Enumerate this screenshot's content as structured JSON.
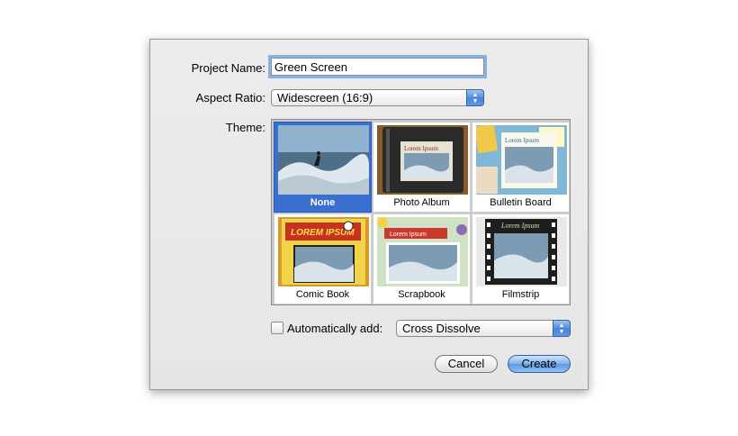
{
  "project_name": {
    "label": "Project Name:",
    "value": "Green Screen"
  },
  "aspect_ratio": {
    "label": "Aspect Ratio:",
    "value": "Widescreen (16:9)"
  },
  "theme": {
    "label": "Theme:",
    "selected": "None",
    "items": [
      {
        "name": "None",
        "thumb_text": ""
      },
      {
        "name": "Photo Album",
        "thumb_text": "Lorem Ipsum"
      },
      {
        "name": "Bulletin Board",
        "thumb_text": "Lorem Ipsum"
      },
      {
        "name": "Comic Book",
        "thumb_text": "LOREM IPSUM"
      },
      {
        "name": "Scrapbook",
        "thumb_text": "Lorem Ipsum"
      },
      {
        "name": "Filmstrip",
        "thumb_text": "Lorem Ipsum"
      }
    ]
  },
  "auto_add": {
    "label": "Automatically add:",
    "checked": false,
    "value": "Cross Dissolve"
  },
  "buttons": {
    "cancel": "Cancel",
    "create": "Create"
  },
  "colors": {
    "selection": "#3a6fd0",
    "focus_ring": "#84b2e9",
    "default_button": "#6fa6ea"
  }
}
